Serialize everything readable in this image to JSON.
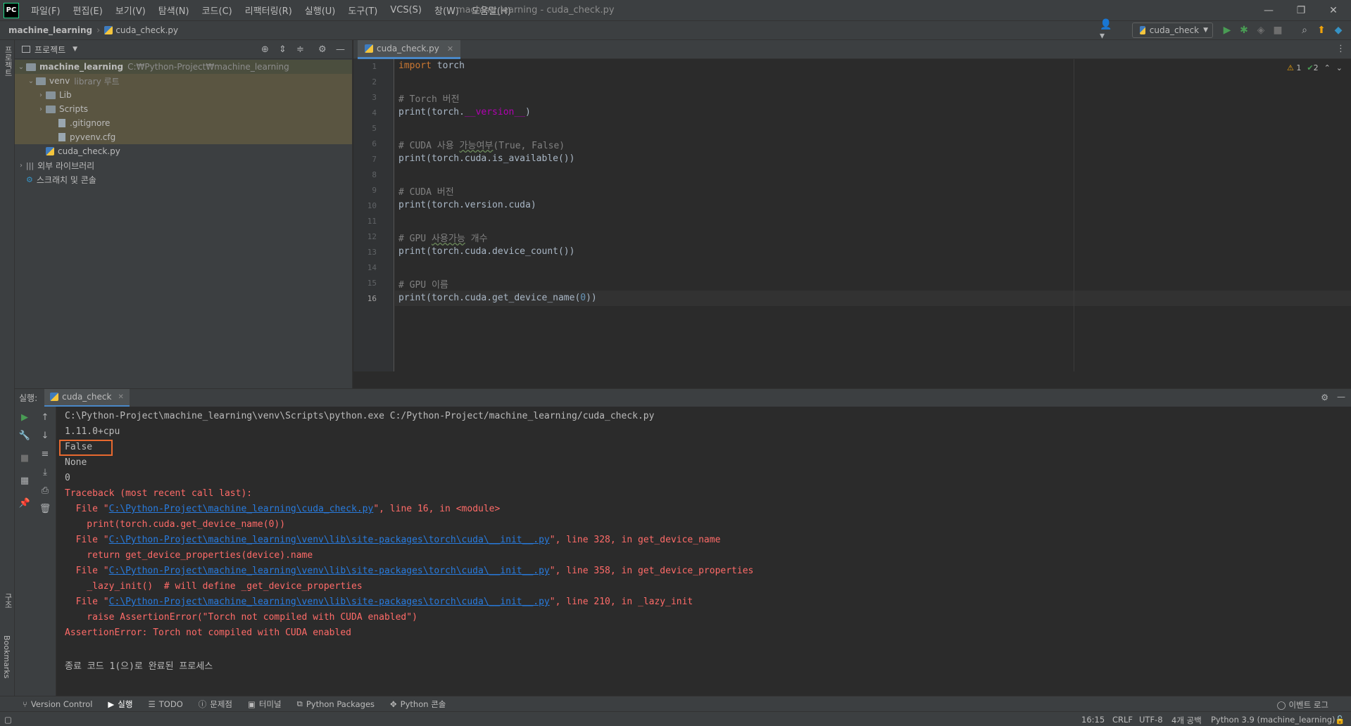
{
  "app": {
    "logo": "PC",
    "window_title": "machine_learning - cuda_check.py"
  },
  "menu": [
    "파일(F)",
    "편집(E)",
    "보기(V)",
    "탐색(N)",
    "코드(C)",
    "리팩터링(R)",
    "실행(U)",
    "도구(T)",
    "VCS(S)",
    "창(W)",
    "도움말(H)"
  ],
  "window_controls": {
    "minimize": "—",
    "maximize": "❐",
    "close": "✕"
  },
  "breadcrumb": {
    "project": "machine_learning",
    "file": "cuda_check.py"
  },
  "toolbar": {
    "run_config": "cuda_check"
  },
  "left_stripe": {
    "project": "프로젝트",
    "structure": "구조",
    "bookmarks": "Bookmarks"
  },
  "project_panel": {
    "title": "프로젝트",
    "tree": [
      {
        "label": "machine_learning",
        "extra": "C:₩Python-Project₩machine_learning"
      },
      {
        "label": "venv",
        "extra": "library 루트"
      },
      {
        "label": "Lib"
      },
      {
        "label": "Scripts"
      },
      {
        "label": ".gitignore"
      },
      {
        "label": "pyvenv.cfg"
      },
      {
        "label": "cuda_check.py"
      },
      {
        "label": "외부 라이브러리"
      },
      {
        "label": "스크래치 및 콘솔"
      }
    ]
  },
  "editor": {
    "tab_label": "cuda_check.py",
    "inspections": {
      "warnings": "1",
      "ok": "2"
    },
    "line_numbers": [
      "1",
      "2",
      "3",
      "4",
      "5",
      "6",
      "7",
      "8",
      "9",
      "10",
      "11",
      "12",
      "13",
      "14",
      "15",
      "16"
    ],
    "code": {
      "l1_kw": "import",
      "l1_rest": " torch",
      "l3": "# Torch 버전",
      "l4_a": "print(torch.",
      "l4_b": "__version__",
      "l4_c": ")",
      "l6_a": "# CUDA 사용 ",
      "l6_b": "가능여부",
      "l6_c": "(True, False)",
      "l7": "print(torch.cuda.is_available())",
      "l9": "# CUDA 버전",
      "l10": "print(torch.version.cuda)",
      "l12_a": "# GPU ",
      "l12_b": "사용가능",
      "l12_c": " 개수",
      "l13": "print(torch.cuda.device_count())",
      "l15": "# GPU 이름",
      "l16_a": "print(torch.cuda.get_device_name(",
      "l16_b": "0",
      "l16_c": "))"
    }
  },
  "run": {
    "header_label": "실행:",
    "tab_label": "cuda_check",
    "console": {
      "cmd": "C:\\Python-Project\\machine_learning\\venv\\Scripts\\python.exe C:/Python-Project/machine_learning/cuda_check.py",
      "out1": "1.11.0+cpu",
      "out2": "False",
      "out3": "None",
      "out4": "0",
      "tb_head": "Traceback (most recent call last):",
      "f1_pre": "  File \"",
      "f1_link": "C:\\Python-Project\\machine_learning\\cuda_check.py",
      "f1_post": "\", line 16, in <module>",
      "f1_code": "    print(torch.cuda.get_device_name(0))",
      "f2_pre": "  File \"",
      "f2_link": "C:\\Python-Project\\machine_learning\\venv\\lib\\site-packages\\torch\\cuda\\__init__.py",
      "f2_post": "\", line 328, in get_device_name",
      "f2_code": "    return get_device_properties(device).name",
      "f3_pre": "  File \"",
      "f3_link": "C:\\Python-Project\\machine_learning\\venv\\lib\\site-packages\\torch\\cuda\\__init__.py",
      "f3_post": "\", line 358, in get_device_properties",
      "f3_code": "    _lazy_init()  # will define _get_device_properties",
      "f4_pre": "  File \"",
      "f4_link": "C:\\Python-Project\\machine_learning\\venv\\lib\\site-packages\\torch\\cuda\\__init__.py",
      "f4_post": "\", line 210, in _lazy_init",
      "f4_code": "    raise AssertionError(\"Torch not compiled with CUDA enabled\")",
      "error": "AssertionError: Torch not compiled with CUDA enabled",
      "exit": "종료 코드 1(으)로 완료된 프로세스"
    }
  },
  "tool_tabs": [
    "Version Control",
    "실행",
    "TODO",
    "문제점",
    "터미널",
    "Python Packages",
    "Python 콘솔"
  ],
  "event_log": "이벤트 로그",
  "status": {
    "position": "16:15",
    "line_sep": "CRLF",
    "encoding": "UTF-8",
    "indent": "4개 공백",
    "interpreter": "Python 3.9 (machine_learning)"
  },
  "colors": {
    "accent": "#4a88c7",
    "error": "#ff6b68",
    "link": "#287bde",
    "highlight_box": "#e8692f",
    "run_green": "#499c54"
  }
}
